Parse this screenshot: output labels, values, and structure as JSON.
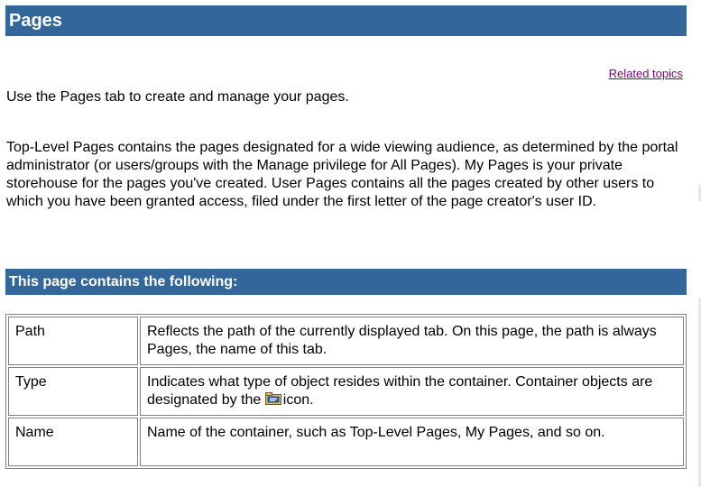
{
  "header": {
    "title": "Pages"
  },
  "related_topics_label": "Related topics",
  "intro_text": "Use the Pages tab to create and manage your pages.",
  "description_text": "Top-Level Pages contains the pages designated for a wide viewing audience, as determined by the portal administrator (or users/groups with the Manage privilege for All Pages). My Pages is your private storehouse for the pages you've created. User Pages contains all the pages created by other users to which you have been granted access, filed under the first letter of the page creator's user ID.",
  "section": {
    "title": "This page contains the following:"
  },
  "table": {
    "rows": [
      {
        "term": "Path",
        "definition": "Reflects the path of the currently displayed tab. On this page, the path is always Pages, the name of this tab."
      },
      {
        "term": "Type",
        "definition_before_icon": "Indicates what type of object resides within the container. Container objects are designated by the",
        "definition_after_icon": "icon.",
        "icon": "container-icon"
      },
      {
        "term": "Name",
        "definition": "Name of the container, such as Top-Level Pages, My Pages, and so on."
      }
    ]
  },
  "colors": {
    "header_bar": "#336699",
    "link_visited": "#800080",
    "table_border": "#808080"
  }
}
